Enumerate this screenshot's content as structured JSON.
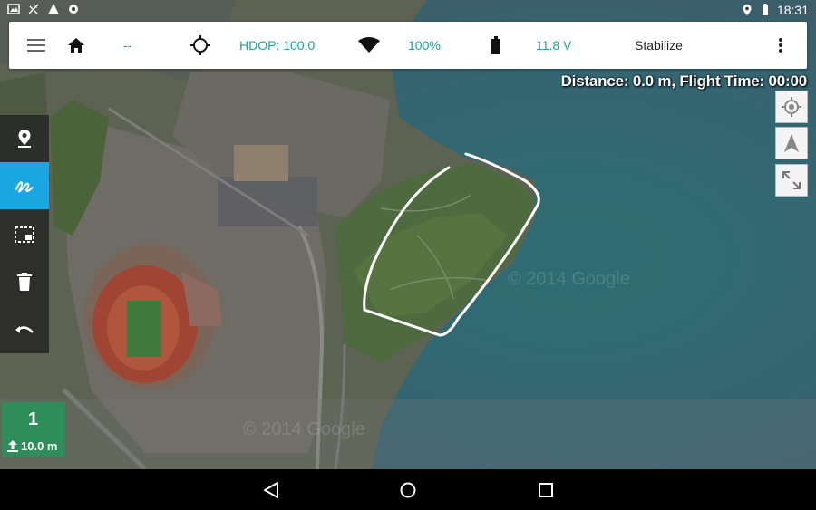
{
  "status_bar": {
    "left_icons": [
      "gallery-icon",
      "no-gps-icon",
      "warning-icon",
      "settings-icon"
    ],
    "right_icons": [
      "location-icon",
      "battery-icon"
    ],
    "time": "18:31"
  },
  "toolbar": {
    "menu_icon": "menu-icon",
    "home_icon": "home-icon",
    "home_value": "--",
    "gps_icon": "crosshair-icon",
    "hdop": "HDOP: 100.0",
    "signal_icon": "wifi-icon",
    "signal": "100%",
    "battery_icon": "battery-icon",
    "voltage": "11.8 V",
    "mode": "Stabilize",
    "overflow_icon": "more-vert-icon"
  },
  "map": {
    "distance_info": "Distance: 0.0 m, Flight Time: 00:00",
    "watermarks": [
      "© 2014 Google",
      "© 2014 Google"
    ]
  },
  "map_buttons": [
    "my-location-icon",
    "navigation-icon",
    "fit-bounds-icon"
  ],
  "tools": [
    {
      "name": "marker-tool",
      "icon": "map-pin-icon",
      "active": false
    },
    {
      "name": "draw-tool",
      "icon": "draw-gesture-icon",
      "active": true
    },
    {
      "name": "select-tool",
      "icon": "select-area-icon",
      "active": false
    },
    {
      "name": "delete-tool",
      "icon": "trash-icon",
      "active": false
    },
    {
      "name": "undo-tool",
      "icon": "undo-icon",
      "active": false
    }
  ],
  "waypoint": {
    "number": "1",
    "altitude": "10.0 m"
  },
  "nav_bar": [
    "back-icon",
    "home-circle-icon",
    "recents-icon"
  ],
  "colors": {
    "accent_teal": "#19a39a",
    "active_tool": "#1aa6e0",
    "waypoint_green": "#2f8d5a"
  }
}
